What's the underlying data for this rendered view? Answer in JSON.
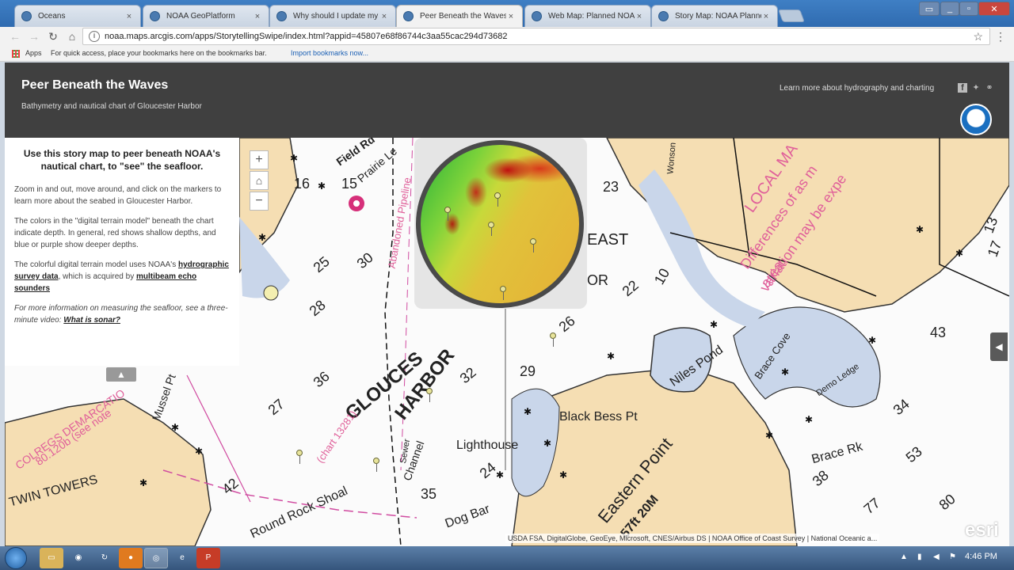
{
  "browser": {
    "tabs": [
      {
        "label": "Oceans",
        "active": false
      },
      {
        "label": "NOAA GeoPlatform",
        "active": false
      },
      {
        "label": "Why should I update my",
        "active": false
      },
      {
        "label": "Peer Beneath the Waves",
        "active": true
      },
      {
        "label": "Web Map: Planned NOAA",
        "active": false
      },
      {
        "label": "Story Map: NOAA Planne",
        "active": false
      }
    ],
    "tab_close_glyph": "×",
    "url": "noaa.maps.arcgis.com/apps/StorytellingSwipe/index.html?appid=45807e68f86744c3aa55cac294d73682",
    "bookmarks": {
      "apps_label": "Apps",
      "hint": "For quick access, place your bookmarks here on the bookmarks bar.",
      "import_link": "Import bookmarks now..."
    }
  },
  "header": {
    "title": "Peer Beneath the Waves",
    "subtitle": "Bathymetry and nautical chart of Gloucester Harbor",
    "learn_more": "Learn more about hydrography and charting"
  },
  "panel": {
    "heading": "Use this story map to peer beneath NOAA's nautical chart, to \"see\" the seafloor.",
    "p1": "Zoom in and out, move around, and click on the markers to learn more about the seabed in Gloucester Harbor.",
    "p2": "The colors in the \"digital terrain model\" beneath the chart indicate depth. In general, red shows shallow depths, and blue or purple show deeper depths.",
    "p3_pre": "The colorful digital terrain model uses NOAA's",
    "p3_link1": "hydrographic survey data",
    "p3_mid": ", which is acquired by",
    "p3_link2": "multibeam echo sounders",
    "p4_pre": "For more information on measuring the seafloor, see a three-minute video:",
    "p4_link": "What is sonar?"
  },
  "map": {
    "zoom_in": "+",
    "zoom_out": "−",
    "home": "⌂",
    "attribution": "USDA FSA, DigitalGlobe, GeoEye, Microsoft, CNES/Airbus DS | NOAA Office of Coast Survey | National Oceanic a...",
    "esri": "esri",
    "labels": {
      "gloucester": "GLOUCES",
      "harbor": "HARBOR",
      "niles_pond": "Niles Pond",
      "black_bess": "Black Bess Pt",
      "eastern_point": "Eastern Point",
      "eastern_point_sub": "57ft 20M",
      "lighthouse": "Lighthouse",
      "dog_bar": "Dog Bar",
      "round_rock": "Round Rock Shoal",
      "brace_rk": "Brace Rk",
      "brace_cove": "Brace Cove",
      "twin_towers": "TWIN TOWERS",
      "local_mag": "LOCAL MA",
      "differences": "Differences of as m",
      "variation": "variation may be expe",
      "area": "area.",
      "colregs": "COLREGS DEMARCATIO",
      "colregs_sub": "80.120b (see note",
      "chart": "(chart 13281)",
      "abandoned": "Abandoned Pipeline",
      "east": "EAST",
      "or": "OR",
      "field_rd": "Field Rd",
      "prairie": "Prairie Le",
      "mussel": "Mussel Pt",
      "channel": "Channel",
      "sewer": "Sewer",
      "demo": "Demo Ledge",
      "wonson": "Wonson"
    },
    "soundings": [
      "16",
      "15",
      "25",
      "30",
      "28",
      "36",
      "27",
      "42",
      "29",
      "24",
      "23",
      "22",
      "10",
      "26",
      "32",
      "34",
      "35",
      "43",
      "53",
      "77",
      "80",
      "38",
      "13",
      "17"
    ]
  },
  "taskbar": {
    "clock": "4:46 PM"
  }
}
